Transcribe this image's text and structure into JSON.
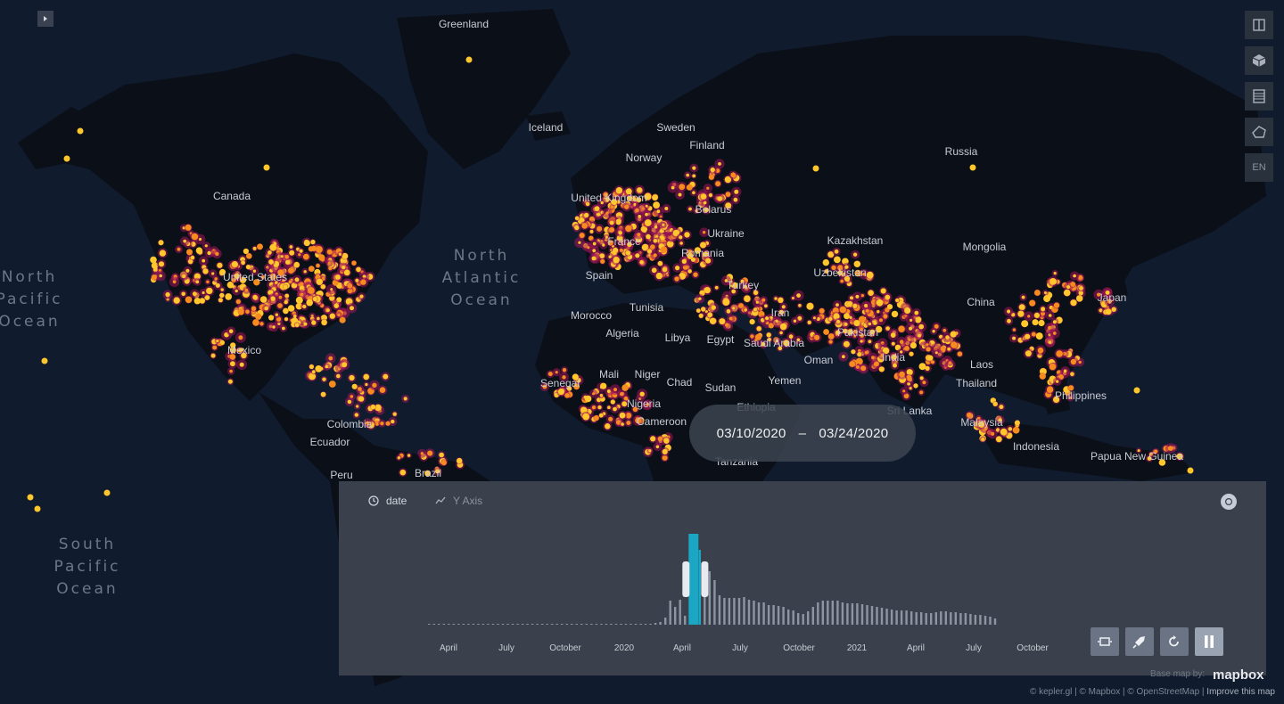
{
  "map": {
    "labels": [
      "Greenland",
      "Iceland",
      "Sweden",
      "Finland",
      "Norway",
      "Russia",
      "Canada",
      "Kazakhstan",
      "Mongolia",
      "Uzbekistan",
      "Belarus",
      "Ukraine",
      "Romania",
      "Spain",
      "Turkey",
      "Morocco",
      "Tunisia",
      "Algeria",
      "Libya",
      "Egypt",
      "Iran",
      "Pakistan",
      "China",
      "Japan",
      "Mexico",
      "Mali",
      "Niger",
      "Chad",
      "Sudan",
      "Senegal",
      "Nigeria",
      "Saudi Arabia",
      "Oman",
      "Yemen",
      "Ethiopia",
      "India",
      "Laos",
      "Thailand",
      "Philippines",
      "Malaysia",
      "Indonesia",
      "Papua New Guinea",
      "Colombia",
      "Ecuador",
      "Peru",
      "Brazil",
      "Sri Lanka",
      "Cameroon",
      "Tanzania",
      "United States",
      "France",
      "United Kingdom"
    ],
    "oceans": [
      {
        "lines": [
          "North",
          "Pacific",
          "Ocean"
        ]
      },
      {
        "lines": [
          "North",
          "Atlantic",
          "Ocean"
        ]
      },
      {
        "lines": [
          "South",
          "Pacific",
          "Ocean"
        ]
      }
    ],
    "dot_colors": {
      "core": "#ffc72c",
      "mid": "#f78c1e",
      "halo": "#a3165a"
    }
  },
  "controls": {
    "collapse_icon": "chevron-right-icon",
    "language": "EN"
  },
  "range": {
    "start": "03/10/2020",
    "separator": "–",
    "end": "03/24/2020"
  },
  "timeline": {
    "field": "date",
    "y_axis": "Y Axis",
    "ticks": [
      "April",
      "July",
      "October",
      "2020",
      "April",
      "July",
      "October",
      "2021",
      "April",
      "July",
      "October"
    ]
  },
  "chart_data": {
    "type": "bar",
    "title": "",
    "xlabel": "",
    "ylabel": "",
    "x_start": "2019-03-04",
    "bin": "week",
    "highlight_window": [
      "2020-03-10",
      "2020-03-24"
    ],
    "values": [
      1,
      1,
      1,
      1,
      1,
      1,
      1,
      1,
      1,
      1,
      1,
      1,
      1,
      1,
      1,
      1,
      1,
      1,
      1,
      1,
      1,
      1,
      1,
      1,
      1,
      1,
      1,
      1,
      1,
      1,
      1,
      1,
      1,
      1,
      1,
      1,
      1,
      1,
      1,
      1,
      1,
      1,
      1,
      1,
      1,
      1,
      2,
      3,
      8,
      27,
      20,
      28,
      10,
      100,
      94,
      84,
      70,
      60,
      50,
      33,
      30,
      30,
      30,
      30,
      31,
      28,
      27,
      25,
      25,
      22,
      22,
      21,
      20,
      17,
      16,
      13,
      12,
      15,
      20,
      25,
      27,
      27,
      27,
      27,
      25,
      24,
      24,
      24,
      23,
      22,
      21,
      20,
      19,
      18,
      17,
      16,
      16,
      16,
      15,
      14,
      14,
      13,
      13,
      14,
      15,
      15,
      14,
      14,
      13,
      13,
      12,
      11,
      11,
      10,
      9,
      7
    ],
    "colors": {
      "bar": "#8d95a3",
      "selected": "#1ba6c4",
      "handle": "#e7eaee"
    }
  },
  "playback": {
    "buttons": [
      "window-mode-icon",
      "speed-rocket-icon",
      "reset-icon",
      "pause-icon"
    ]
  },
  "footer": {
    "basemap_by": "Base map by:",
    "mapbox": "mapbox",
    "attribution": "© kepler.gl | © Mapbox | © OpenStreetMap |",
    "improve": "Improve this map"
  }
}
